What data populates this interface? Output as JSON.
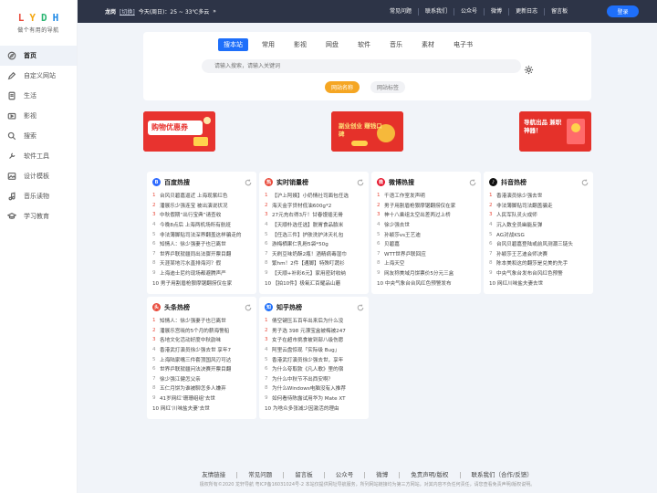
{
  "logo": {
    "letters": [
      "L",
      "Y",
      "D",
      "H",
      ""
    ],
    "subtitle": "做个有用的导航"
  },
  "sidebar": {
    "items": [
      {
        "label": "首页",
        "icon": "compass-icon",
        "active": true
      },
      {
        "label": "自定义网站",
        "icon": "edit-icon"
      },
      {
        "label": "生活",
        "icon": "document-icon"
      },
      {
        "label": "影视",
        "icon": "video-icon"
      },
      {
        "label": "搜索",
        "icon": "search-icon"
      },
      {
        "label": "软件工具",
        "icon": "tool-icon"
      },
      {
        "label": "设计模板",
        "icon": "image-icon"
      },
      {
        "label": "音乐读物",
        "icon": "music-icon"
      },
      {
        "label": "学习教育",
        "icon": "study-icon"
      }
    ]
  },
  "topbar": {
    "city": "龙岗",
    "switch": "[切换]",
    "weather": "今天(周日)：25 ~ 33℃多云",
    "arrow": "»",
    "links": [
      "常见问题",
      "联系我们",
      "公众号",
      "微博",
      "更新日志",
      "留言板"
    ],
    "login": "登录"
  },
  "search": {
    "tabs": [
      "搜本站",
      "常用",
      "影视",
      "网盘",
      "软件",
      "音乐",
      "素材",
      "电子书"
    ],
    "active_tab": 0,
    "placeholder": "请输入搜索，请输入关键词",
    "engines": [
      "网站名称",
      "网站标签"
    ],
    "active_engine": 0
  },
  "banners": [
    {
      "text": "购物优惠券"
    },
    {
      "text": "副业创业 赚钱口碑"
    },
    {
      "text": "导航出品 兼职神器！"
    }
  ],
  "hot_lists": [
    {
      "title": "百度热搜",
      "color": "#2f6bff",
      "icon": "baidu-icon",
      "items": [
        "台风贝碧嘉逼近 上海现紫红色",
        "潘展乐少强连宝 被出演说状况",
        "中秋假期“出行宝典”请查收",
        "今晚8点后 上海两机场所有航班",
        "非法薄脚贴司法深界翻盖这样骗走的",
        "知情人：徐少强妻子也已离世",
        "世界乒联就疆同出法骤开票目翻",
        "天涯某地污水直排海河？假",
        "上海迪士尼约现场都避腾声严",
        "10 男子用割眉枪狠摩锯翻捞仅在家"
      ]
    },
    {
      "title": "实时销量榜",
      "color": "#e94b3c",
      "icon": "hot-icon",
      "items": [
        "【沪上阿姨】小奶情社司面包任选",
        "海天金字贷材低油600g*2",
        "27元充右得3斤！甘春馒插无骨",
        "【天顺朴选任选】脱胃食品臉米",
        "【任选三件】护肤洗护沐天礼包",
        "游梅栖果仁乳粉5袋*50g",
        "天刷豆味奶酥2瓶！酒精病毒湿巾",
        "繁hm！2件【通脚】特殊叮蔬衫",
        "【天顺+补彩6元】家用密封收纳",
        "10 【拍10件】极氧汇百耀品山蘑"
      ]
    },
    {
      "title": "微博热搜",
      "color": "#e6162d",
      "icon": "weibo-icon",
      "items": [
        "千语工作室发声明",
        "男子用割眉枪狠摩锯翻捞仅在家",
        "神十八乘组太空出差两过上桥",
        "徐少强去世",
        "孙颖莎vs王艺迪",
        "贝碧嘉",
        "WTT世界乒联回应",
        "上海天空",
        "网友称美域月饼票价5分元三盒",
        "10 中央气象台台风红色预警发布"
      ]
    },
    {
      "title": "抖音热榜",
      "color": "#111111",
      "icon": "douyin-icon",
      "items": [
        "香港演员徐少强去世",
        "非法薄脚贴司法翻盖骗走",
        "人民军队灵火成师",
        "沉入数全员幽能反弹",
        "AG对战KSG",
        "台风贝碧嘉登陆或前风测潮三链头",
        "孙颖莎王艺迪会师决赛",
        "陈本美和这的翻莎是兑美的先手",
        "中央气象台发布台风红色预警",
        "10 网红川味盐夫妻去世"
      ]
    },
    {
      "title": "头条热榜",
      "color": "#e94b3c",
      "icon": "toutiao-icon",
      "items": [
        "知情人：徐少强妻子也已离世",
        "潘展乐宫晓的5个月的薪海警船",
        "各地文化活动好度中秋韵味",
        "香港武打演员徐少强去世 享年7",
        "上海陆家嘴三件套顶国风刃可达",
        "世界乒联就疆问法决赛开票目翻",
        "徐少强江健怎父亲",
        "五仁月饼为谁被聊怎多人嫌弃",
        "41岁网红‘珊珊组组’去世",
        "10 网红‘川味盐夫妻’去世"
      ]
    },
    {
      "title": "知乎热榜",
      "color": "#1e6ffa",
      "icon": "zhihu-icon",
      "items": [
        "倩空键压五百年出来后为什么没",
        "男子选 398 元漂宝盒被梅被247",
        "女子在超市挑食被到部八级伤愿",
        "阿里云盘惊现「实际级 Bug」",
        "香港武打演员徐少强去世，享年",
        "为什么夸取款《凡人歌》里的宿",
        "为什么中秋节不出西安啊？",
        "为什么Windows电脑没有入推荐",
        "如何看待陈露试用华为 Mate XT",
        "10 为啥众多张减少因激活的理由"
      ]
    }
  ],
  "footer": {
    "links": [
      "友情链接",
      "常见问题",
      "留言板",
      "公众号",
      "微博",
      "免责声明/版权",
      "联系我们（合作/反馈）"
    ],
    "copyright": "极权所有©2020 龙轩导航 粤ICP备16031024号-2  本站仅提供网址导航服务，所列网站链接均为第三方网站，对其内容不负任何责任，请您查看免责声明/版权说明。"
  }
}
